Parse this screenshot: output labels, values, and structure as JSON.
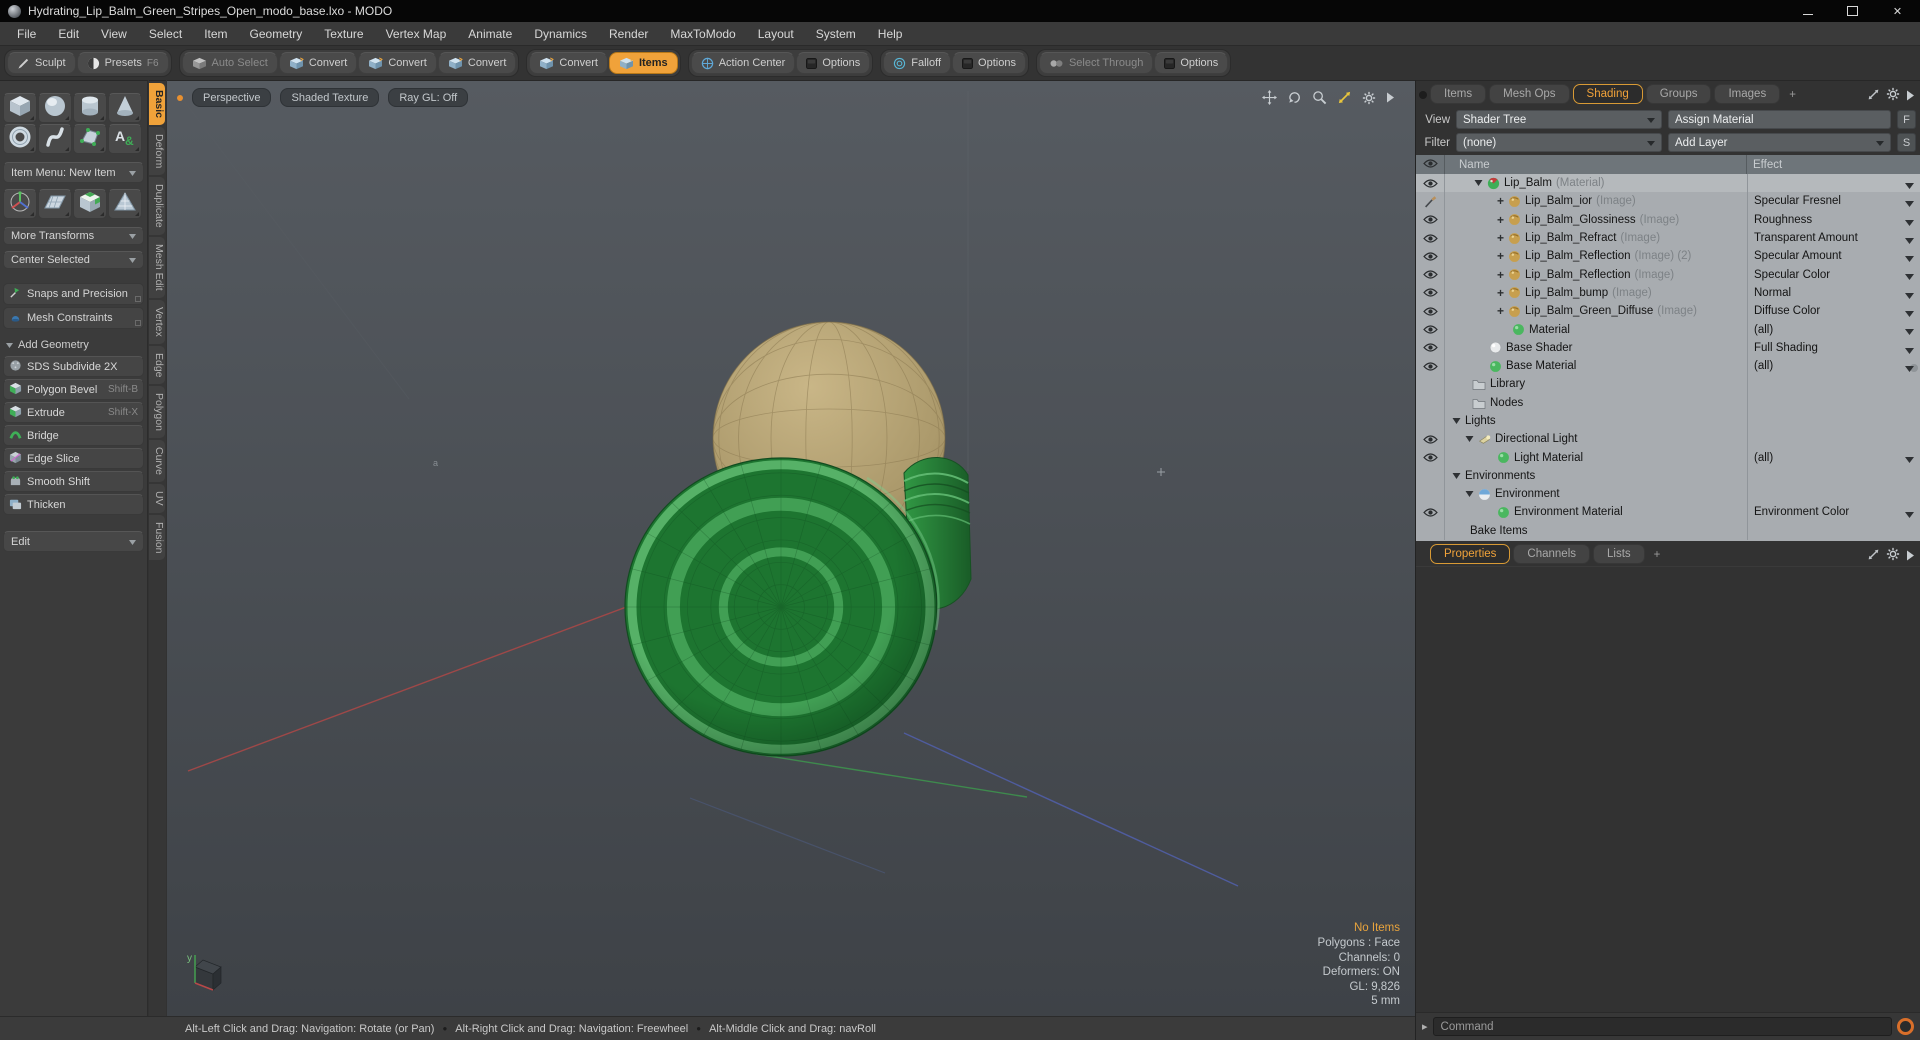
{
  "window": {
    "title": "Hydrating_Lip_Balm_Green_Stripes_Open_modo_base.lxo - MODO"
  },
  "menu": [
    "File",
    "Edit",
    "View",
    "Select",
    "Item",
    "Geometry",
    "Texture",
    "Vertex Map",
    "Animate",
    "Dynamics",
    "Render",
    "MaxToModo",
    "Layout",
    "System",
    "Help"
  ],
  "toolbar": {
    "groups": [
      {
        "buttons": [
          {
            "label": "Sculpt",
            "icon": "pencil"
          },
          {
            "label": "Presets",
            "shortcut": "F6",
            "icon": "psphere"
          }
        ]
      },
      {
        "buttons": [
          {
            "label": "Auto Select",
            "icon": "cubegray",
            "disabled": true
          },
          {
            "label": "Convert",
            "icon": "cube"
          },
          {
            "label": "Convert",
            "icon": "cube"
          },
          {
            "label": "Convert",
            "icon": "cube"
          }
        ]
      },
      {
        "buttons": [
          {
            "label": "Convert",
            "icon": "cube"
          },
          {
            "label": "Items",
            "icon": "cube",
            "active": true
          }
        ]
      },
      {
        "buttons": [
          {
            "label": "Action Center",
            "icon": "action"
          },
          {
            "label": "Options",
            "icon": "checkbox"
          }
        ]
      },
      {
        "buttons": [
          {
            "label": "Falloff",
            "icon": "falloff"
          },
          {
            "label": "Options",
            "icon": "checkbox"
          }
        ]
      },
      {
        "buttons": [
          {
            "label": "Select Through",
            "icon": "selthrough",
            "disabled": true
          },
          {
            "label": "Options",
            "icon": "checkbox"
          }
        ]
      }
    ]
  },
  "left_panel": {
    "primitive_rows": [
      [
        "cubeL",
        "sphereL",
        "cylL",
        "coneL"
      ],
      [
        "torusL",
        "helixL",
        "penL",
        "textL"
      ]
    ],
    "item_menu": "Item Menu: New Item",
    "transform_icons": [
      "gizmoL",
      "planeL",
      "checkerL",
      "meshL"
    ],
    "more_transforms": "More Transforms",
    "center_selected": "Center Selected",
    "snaps": "Snaps and Precision",
    "mesh_constraints": "Mesh Constraints",
    "add_geometry": "Add Geometry",
    "tools": [
      {
        "label": "SDS Subdivide 2X",
        "shortcut": "",
        "icon": "gsds"
      },
      {
        "label": "Polygon Bevel",
        "shortcut": "Shift-B",
        "icon": "gbevel"
      },
      {
        "label": "Extrude",
        "shortcut": "Shift-X",
        "icon": "gbevel"
      },
      {
        "label": "Bridge",
        "shortcut": "",
        "icon": "gbridge"
      },
      {
        "label": "Edge Slice",
        "shortcut": "",
        "icon": "gslice"
      },
      {
        "label": "Smooth Shift",
        "shortcut": "",
        "icon": "gsmooth"
      },
      {
        "label": "Thicken",
        "shortcut": "",
        "icon": "gthicken"
      }
    ],
    "edit": "Edit"
  },
  "side_tabs": [
    {
      "label": "Basic",
      "active": true
    },
    {
      "label": "Deform"
    },
    {
      "label": "Duplicate"
    },
    {
      "label": "Mesh Edit"
    },
    {
      "label": "Vertex"
    },
    {
      "label": "Edge"
    },
    {
      "label": "Polygon"
    },
    {
      "label": "Curve"
    },
    {
      "label": "UV"
    },
    {
      "label": "Fusion"
    }
  ],
  "viewport": {
    "header": [
      "Perspective",
      "Shaded Texture",
      "Ray GL: Off"
    ],
    "stats": [
      {
        "text": "No Items",
        "highlight": true
      },
      {
        "text": "Polygons : Face"
      },
      {
        "text": "Channels: 0"
      },
      {
        "text": "Deformers: ON"
      },
      {
        "text": "GL: 9,826"
      },
      {
        "text": "5 mm"
      }
    ],
    "axis_label": "y"
  },
  "right_panel": {
    "tabs": [
      {
        "label": "Items"
      },
      {
        "label": "Mesh Ops"
      },
      {
        "label": "Shading",
        "active": true
      },
      {
        "label": "Groups"
      },
      {
        "label": "Images"
      },
      {
        "label": "+",
        "plus": true
      }
    ],
    "view_label": "View",
    "view_value": "Shader Tree",
    "assign_material": "Assign Material",
    "f_button": "F",
    "filter_label": "Filter",
    "filter_value": "(none)",
    "add_layer": "Add Layer",
    "s_button": "S",
    "columns": {
      "name": "Name",
      "effect": "Effect"
    },
    "tree": [
      {
        "pad": 29,
        "exp": "tri",
        "icon": "material",
        "label": "Lip_Balm",
        "suffix": "(Material)",
        "effect": "",
        "eye": "eye",
        "arrow": true,
        "selected": true
      },
      {
        "pad": 52,
        "exp": "plus",
        "icon": "image",
        "label": "Lip_Balm_ior",
        "suffix": "(Image)",
        "effect": "Specular Fresnel",
        "eye": "brush",
        "arrow": true
      },
      {
        "pad": 52,
        "exp": "plus",
        "icon": "image",
        "label": "Lip_Balm_Glossiness",
        "suffix": "(Image)",
        "effect": "Roughness",
        "eye": "eye",
        "arrow": true
      },
      {
        "pad": 52,
        "exp": "plus",
        "icon": "image",
        "label": "Lip_Balm_Refract",
        "suffix": "(Image)",
        "effect": "Transparent Amount",
        "eye": "eye",
        "arrow": true
      },
      {
        "pad": 52,
        "exp": "plus",
        "icon": "image",
        "label": "Lip_Balm_Reflection",
        "suffix": "(Image) (2)",
        "effect": "Specular Amount",
        "eye": "eye",
        "arrow": true
      },
      {
        "pad": 52,
        "exp": "plus",
        "icon": "image",
        "label": "Lip_Balm_Reflection",
        "suffix": "(Image)",
        "effect": "Specular Color",
        "eye": "eye",
        "arrow": true
      },
      {
        "pad": 52,
        "exp": "plus",
        "icon": "image",
        "label": "Lip_Balm_bump",
        "suffix": "(Image)",
        "effect": "Normal",
        "eye": "eye",
        "arrow": true
      },
      {
        "pad": 52,
        "exp": "plus",
        "icon": "image",
        "label": "Lip_Balm_Green_Diffuse",
        "suffix": "(Image)",
        "effect": "Diffuse Color",
        "eye": "eye",
        "arrow": true
      },
      {
        "pad": 67,
        "exp": "none",
        "icon": "sgreen",
        "label": "Material",
        "suffix": "",
        "effect": "(all)",
        "eye": "eye",
        "arrow": true
      },
      {
        "pad": 44,
        "exp": "none",
        "icon": "swhite",
        "label": "Base Shader",
        "suffix": "",
        "effect": "Full Shading",
        "eye": "eye",
        "arrow": true
      },
      {
        "pad": 44,
        "exp": "none",
        "icon": "sgreen",
        "label": "Base Material",
        "suffix": "",
        "effect": "(all)",
        "eye": "eye",
        "arrow": true
      },
      {
        "pad": 27,
        "exp": "none",
        "icon": "folder",
        "label": "Library",
        "suffix": "",
        "effect": "",
        "eye": "none"
      },
      {
        "pad": 27,
        "exp": "none",
        "icon": "folder",
        "label": "Nodes",
        "suffix": "",
        "effect": "",
        "eye": "none"
      },
      {
        "pad": 7,
        "exp": "tri",
        "icon": "none",
        "label": "Lights",
        "suffix": "",
        "effect": "",
        "eye": "none"
      },
      {
        "pad": 20,
        "exp": "tri",
        "icon": "light",
        "label": "Directional Light",
        "suffix": "",
        "effect": "",
        "eye": "eye"
      },
      {
        "pad": 52,
        "exp": "none",
        "icon": "sgreen",
        "label": "Light Material",
        "suffix": "",
        "effect": "(all)",
        "eye": "eye",
        "arrow": true
      },
      {
        "pad": 7,
        "exp": "tri",
        "icon": "none",
        "label": "Environments",
        "suffix": "",
        "effect": "",
        "eye": "none"
      },
      {
        "pad": 20,
        "exp": "tri",
        "icon": "env",
        "label": "Environment",
        "suffix": "",
        "effect": "",
        "eye": "none"
      },
      {
        "pad": 52,
        "exp": "none",
        "icon": "sgreen",
        "label": "Environment Material",
        "suffix": "",
        "effect": "Environment Color",
        "eye": "eye",
        "arrow": true
      },
      {
        "pad": 25,
        "exp": "none",
        "icon": "none",
        "label": "Bake Items",
        "suffix": "",
        "effect": "",
        "eye": "none"
      }
    ],
    "bottom_tabs": [
      {
        "label": "Properties",
        "active": true
      },
      {
        "label": "Channels"
      },
      {
        "label": "Lists"
      },
      {
        "label": "+",
        "plus": true
      }
    ],
    "command_placeholder": "Command"
  },
  "status_bar": {
    "hints": [
      "Alt-Left Click and Drag: Navigation: Rotate (or Pan)",
      "Alt-Right Click and Drag: Navigation: Freewheel",
      "Alt-Middle Click and Drag: navRoll"
    ]
  },
  "colors": {
    "accent": "#f0a23a",
    "stats_highlight": "#e8a33d",
    "axis_x_red": "#9e4848",
    "axis_green": "#3e8a4d",
    "axis_blue": "#4f5c9e",
    "balm_cap_green": "#1d7530",
    "balm_stick_tan": "#ac9a6c"
  }
}
